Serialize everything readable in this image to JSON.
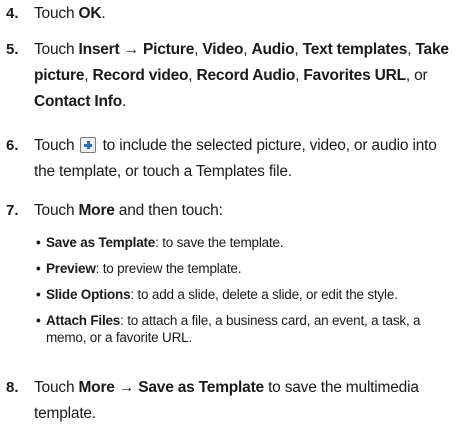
{
  "steps": [
    {
      "number": "4.",
      "pre": "Touch ",
      "bold": "OK",
      "post": "."
    },
    {
      "number": "5.",
      "pre": "Touch ",
      "b1": "Insert → Picture",
      "s1": ", ",
      "b2": "Video",
      "s2": ", ",
      "b3": "Audio",
      "s3": ", ",
      "b4": "Text templates",
      "s4": ", ",
      "b5": "Take picture",
      "s5": ", ",
      "b6": "Record video",
      "s6": ", ",
      "b7": "Record Audio",
      "s7": ", ",
      "b8": "Favorites URL",
      "s8": ", or ",
      "b9": "Contact Info",
      "post": "."
    },
    {
      "number": "6.",
      "pre": "Touch ",
      "icon": "plus-icon",
      "post": " to include the selected picture, video, or audio into the template, or touch a Templates file."
    },
    {
      "number": "7.",
      "pre": "Touch ",
      "bold": "More",
      "post": " and then touch:",
      "bullets": [
        {
          "bold": "Save as Template",
          "text": ": to save the template."
        },
        {
          "bold": "Preview",
          "text": ": to preview the template."
        },
        {
          "bold": "Slide Options",
          "text": ": to add a slide, delete a slide, or edit the style."
        },
        {
          "bold": "Attach Files",
          "text": ": to attach a file, a business card, an event, a task, a memo, or a favorite URL."
        }
      ]
    },
    {
      "number": "8.",
      "pre": "Touch ",
      "bold": "More → Save as Template",
      "post": " to save the multimedia template."
    }
  ],
  "bullet_glyph": "•"
}
